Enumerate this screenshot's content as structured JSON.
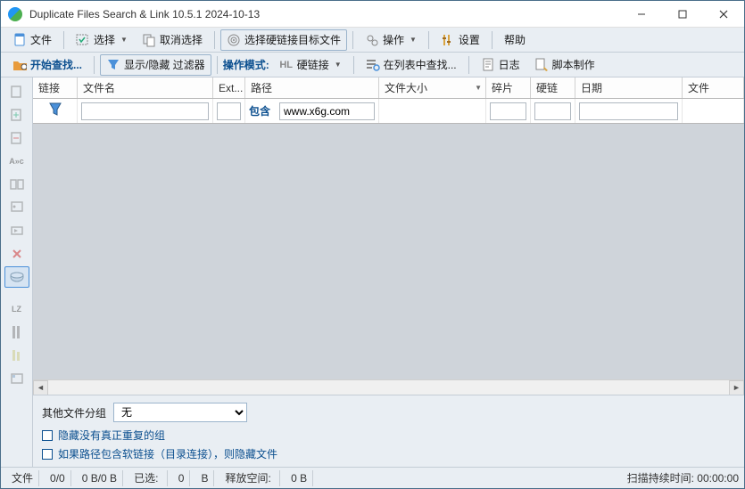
{
  "title": "Duplicate Files Search & Link 10.5.1 2024-10-13",
  "toolbar1": {
    "file": "文件",
    "select": "选择",
    "deselect": "取消选择",
    "chooseHardlinkTarget": "选择硬链接目标文件",
    "operate": "操作",
    "settings": "设置",
    "help": "帮助"
  },
  "toolbar2": {
    "startSearch": "开始查找...",
    "showHideFilter": "显示/隐藏 过滤器",
    "opModeLabel": "操作模式:",
    "hardlink": "硬链接",
    "findInList": "在列表中查找...",
    "log": "日志",
    "scriptMake": "脚本制作"
  },
  "columns": {
    "link": "链接",
    "filename": "文件名",
    "ext": "Ext...",
    "path": "路径",
    "size": "文件大小",
    "fragment": "碎片",
    "hardlink": "硬链",
    "date": "日期",
    "file": "文件"
  },
  "filter": {
    "containsLabel": "包含",
    "pathValue": "www.x6g.com"
  },
  "bottom": {
    "groupLabel": "其他文件分组",
    "groupValue": "无",
    "chk1": "隐藏没有真正重复的组",
    "chk2": "如果路径包含软链接（目录连接），则隐藏文件"
  },
  "status": {
    "filesLabel": "文件",
    "counts": "0/0",
    "bytes": "0 B/0 B",
    "selectedLabel": "已选:",
    "selectedCount": "0",
    "bLabel": "B",
    "freeSpaceLabel": "释放空间:",
    "freeSpaceValue": "0 B",
    "scanDurationLabel": "扫描持续时间:",
    "scanDurationValue": "00:00:00"
  }
}
